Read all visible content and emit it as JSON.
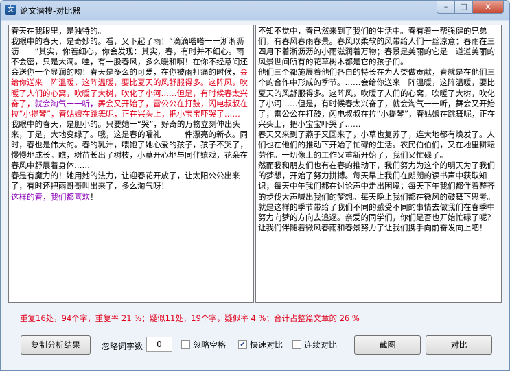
{
  "window": {
    "title": "论文潜搜-对比器",
    "icon_glyph": "文",
    "minimize_glyph": "–",
    "maximize_glyph": "□",
    "close_glyph": "✕"
  },
  "colors": {
    "accent_red": "#e0001b",
    "accent_purple": "#8b00b8"
  },
  "left_pane": {
    "segments": [
      {
        "color": "black",
        "text": "春天在我眼里，是独特的。\n我眼中的春天，是奇妙的。看，又下起了雨！“滴滴嗒嗒一一淅淅沥沥一一”其实，你若细心，你会发现：其实，春，有时并不细心。雨不会密，只是大滴。哇，有一股春风，多么暖和啊！在你不经意间还会送你一个显润的吻！春天是多么的可爱，在你被雨打痛的时候，"
      },
      {
        "color": "red",
        "text": "会给你送来一阵温暖，这阵温暖，要比夏天的风舒服得多。这阵风，吹暖了人们的心窝，吹暖了大树，吹化了小河……但是，有时候春太兴奋了，"
      },
      {
        "color": "purple",
        "text": "就会淘气一一听，"
      },
      {
        "color": "red",
        "text": "舞会又开始了，雷公公在打鼓，闪电叔叔在拉“小提琴”，春姑娘在跳舞呢，正在兴头上，把小宝宝吓哭了……"
      },
      {
        "color": "black",
        "text": "\n我眼中的春天，是胆小的。只要她一“哭”，好奇的万物立刻伸出头来，于是，大地变绿了。哦，这是春的嚯礼一一一件漂亮的新衣。同时，春也是伟大的。春的乳汁，喂饱了她心爱的孩子，孩子不哭了，慢慢地成长。瞧，树苗长出了树枝，小草开心地与同伴嬉戏，花朵在春风中舒展着身体……\n春是有魔力的！她用她的法力，让迎春花开放了，让太阳公公出来了，有时还把雨哥哥叫出来了，多么淘气呀！\n"
      },
      {
        "color": "purple",
        "text": "这样的春，我们都喜欢"
      },
      {
        "color": "black",
        "text": "！"
      }
    ]
  },
  "right_pane": {
    "segments": [
      {
        "color": "black",
        "text": "不知不觉中，春已然来到了我们的生活中。春有着一帮强健的兄弟们，有春风春雨春景。春风以柔软的风带给人们一丝凉意；春雨在三四月下着淅沥沥的小雨滋润着万物；春景是美丽的它是一道道美丽的风景世间所有的花草树木都是它的孩子们。\n他们三个都施展着他们各自的特长在为人类做贡献，春就是在他们三个的合作中形成的季节。……会给你送来一阵温暖，这阵温暖，要比夏天的风舒服得多。这阵风，吹暖了人们的心窝，吹暖了大树，吹化了小河……但是，有时候春太兴奋了，就会淘气一一听，舞会又开始了，雷公公在打鼓，闪电叔叔在拉“小提琴”，春姑娘在跳舞呢，正在兴头上，把小宝宝吓哭了……\n春天又来到了燕子又回来了，小草也复苏了，连大地都有焕发了。人们也在他们的推动下开始了忙碌的生活。农民伯伯们，又在地里耕耘劳作。一切像上的工作又重新开始了，我们又忙碌了。\n然而我和朋友们也有在春的推动下，我们努力为这个的明天为了我们的梦想，开始了努力拼搏。每天早上我们在朗朗的读书声中获取知识；每天中午我们都在讨论声中走出困境；每天下午我们都伴着整齐的步伐大声喊出我们的梦想。每天晚上我们都在微风的鼓舞下思考。就是这样的季节带给了我们不同的感受不同的事情去做我们在春季中努力向梦的方向去追逐。亲爱的同学们，你们是否也开始忙碌了呢？让我们伴随着微风春雨和春景努力了让我们携手向前奋发向上吧！"
      }
    ]
  },
  "summary": "重复16处，94个字，重复率 21 %；疑似11处，19个字，疑似率 4 %；合计占整篇文章的 26 %",
  "controls": {
    "copy_button": "复制分析结果",
    "ignore_label": "忽略词字数",
    "ignore_value": "0",
    "ignore_space": {
      "label": "忽略空格",
      "checked": false
    },
    "fast_compare": {
      "label": "快速对比",
      "checked": true
    },
    "continuous_compare": {
      "label": "连续对比",
      "checked": false
    },
    "screenshot_button": "截图",
    "compare_button": "对比"
  }
}
